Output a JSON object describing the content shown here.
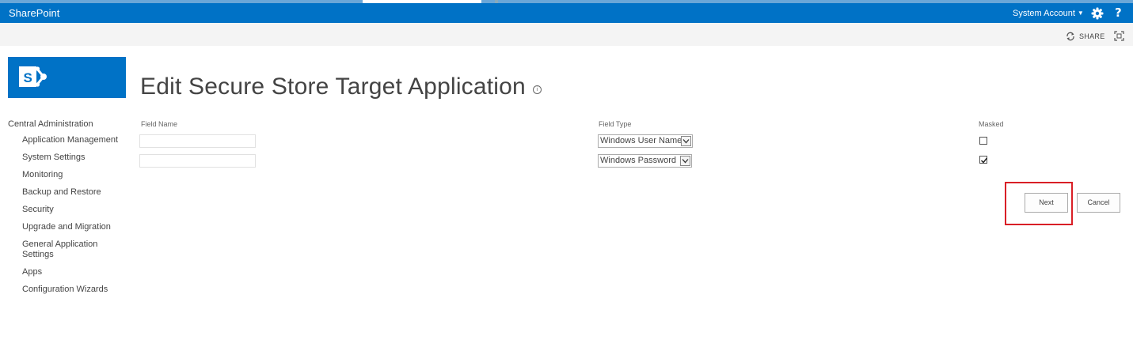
{
  "suite_bar": {
    "brand": "SharePoint",
    "account": "System Account"
  },
  "ribbon": {
    "share_label": "SHARE"
  },
  "page": {
    "title": "Edit Secure Store Target Application"
  },
  "quick_launch": {
    "heading": "Central Administration",
    "items": [
      "Application Management",
      "System Settings",
      "Monitoring",
      "Backup and Restore",
      "Security",
      "Upgrade and Migration",
      "General Application Settings",
      "Apps",
      "Configuration Wizards"
    ]
  },
  "fields_table": {
    "headers": {
      "field_name": "Field Name",
      "field_type": "Field Type",
      "masked": "Masked"
    },
    "rows": [
      {
        "field_name": "",
        "field_type": "Windows User Name",
        "masked": false
      },
      {
        "field_name": "",
        "field_type": "Windows Password",
        "masked": true
      }
    ]
  },
  "buttons": {
    "next": "Next",
    "cancel": "Cancel"
  },
  "colors": {
    "suite_bar": "#0072c6",
    "highlight": "#d91f26"
  },
  "icons": {
    "settings": "gear-icon",
    "help": "help-icon",
    "share": "share-icon",
    "focus": "focus-on-content-icon",
    "info": "info-icon"
  }
}
